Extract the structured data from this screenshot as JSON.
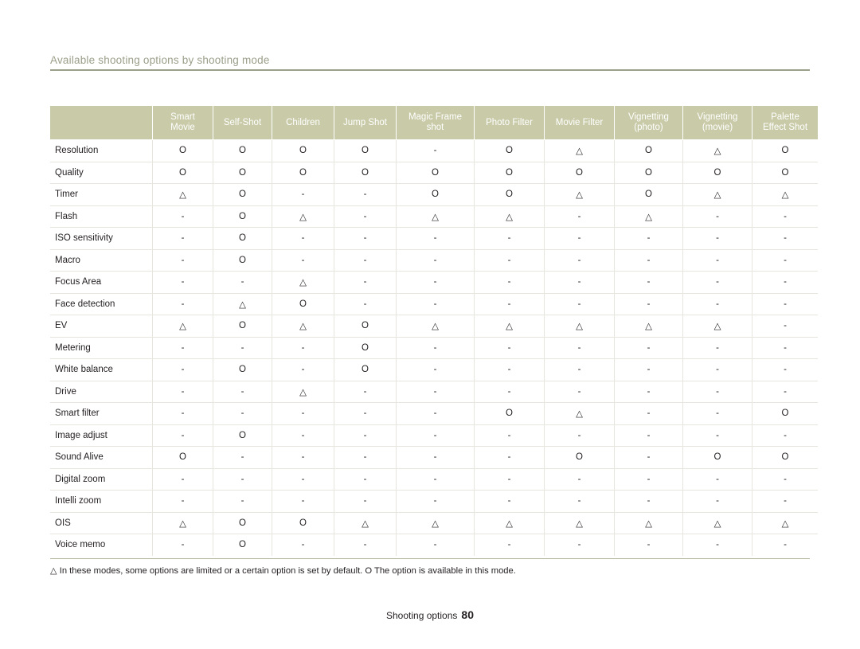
{
  "header": {
    "title": "Available shooting options by shooting mode"
  },
  "table": {
    "columns": [
      {
        "line1": "",
        "line2": "",
        "line3": ""
      },
      {
        "line1": "Smart",
        "line2": "Movie",
        "line3": ""
      },
      {
        "line1": "Self-Shot",
        "line2": "",
        "line3": ""
      },
      {
        "line1": "Children",
        "line2": "",
        "line3": ""
      },
      {
        "line1": "Jump Shot",
        "line2": "",
        "line3": ""
      },
      {
        "line1": "Magic Frame",
        "line2": "shot",
        "line3": ""
      },
      {
        "line1": "Photo Filter",
        "line2": "",
        "line3": ""
      },
      {
        "line1": "Movie Filter",
        "line2": "",
        "line3": ""
      },
      {
        "line1": "Vignetting",
        "line2": "(photo)",
        "line3": ""
      },
      {
        "line1": "Vignetting",
        "line2": "(movie)",
        "line3": ""
      },
      {
        "line1": "Palette",
        "line2": "Effect Shot",
        "line3": ""
      }
    ],
    "rows": [
      {
        "label": "Resolution",
        "cells": [
          "O",
          "O",
          "O",
          "O",
          "-",
          "O",
          "△",
          "O",
          "△",
          "O"
        ]
      },
      {
        "label": "Quality",
        "cells": [
          "O",
          "O",
          "O",
          "O",
          "O",
          "O",
          "O",
          "O",
          "O",
          "O"
        ]
      },
      {
        "label": "Timer",
        "cells": [
          "△",
          "O",
          "-",
          "-",
          "O",
          "O",
          "△",
          "O",
          "△",
          "△"
        ]
      },
      {
        "label": "Flash",
        "cells": [
          "-",
          "O",
          "△",
          "-",
          "△",
          "△",
          "-",
          "△",
          "-",
          "-"
        ]
      },
      {
        "label": "ISO sensitivity",
        "cells": [
          "-",
          "O",
          "-",
          "-",
          "-",
          "-",
          "-",
          "-",
          "-",
          "-"
        ]
      },
      {
        "label": "Macro",
        "cells": [
          "-",
          "O",
          "-",
          "-",
          "-",
          "-",
          "-",
          "-",
          "-",
          "-"
        ]
      },
      {
        "label": "Focus Area",
        "cells": [
          "-",
          "-",
          "△",
          "-",
          "-",
          "-",
          "-",
          "-",
          "-",
          "-"
        ]
      },
      {
        "label": "Face detection",
        "cells": [
          "-",
          "△",
          "O",
          "-",
          "-",
          "-",
          "-",
          "-",
          "-",
          "-"
        ]
      },
      {
        "label": "EV",
        "cells": [
          "△",
          "O",
          "△",
          "O",
          "△",
          "△",
          "△",
          "△",
          "△",
          "-"
        ]
      },
      {
        "label": "Metering",
        "cells": [
          "-",
          "-",
          "-",
          "O",
          "-",
          "-",
          "-",
          "-",
          "-",
          "-"
        ]
      },
      {
        "label": "White balance",
        "cells": [
          "-",
          "O",
          "-",
          "O",
          "-",
          "-",
          "-",
          "-",
          "-",
          "-"
        ]
      },
      {
        "label": "Drive",
        "cells": [
          "-",
          "-",
          "△",
          "-",
          "-",
          "-",
          "-",
          "-",
          "-",
          "-"
        ]
      },
      {
        "label": "Smart filter",
        "cells": [
          "-",
          "-",
          "-",
          "-",
          "-",
          "O",
          "△",
          "-",
          "-",
          "O"
        ]
      },
      {
        "label": "Image adjust",
        "cells": [
          "-",
          "O",
          "-",
          "-",
          "-",
          "-",
          "-",
          "-",
          "-",
          "-"
        ]
      },
      {
        "label": "Sound Alive",
        "cells": [
          "O",
          "-",
          "-",
          "-",
          "-",
          "-",
          "O",
          "-",
          "O",
          "O"
        ]
      },
      {
        "label": "Digital zoom",
        "cells": [
          "-",
          "-",
          "-",
          "-",
          "-",
          "-",
          "-",
          "-",
          "-",
          "-"
        ]
      },
      {
        "label": "Intelli zoom",
        "cells": [
          "-",
          "-",
          "-",
          "-",
          "-",
          "-",
          "-",
          "-",
          "-",
          "-"
        ]
      },
      {
        "label": "OIS",
        "cells": [
          "△",
          "O",
          "O",
          "△",
          "△",
          "△",
          "△",
          "△",
          "△",
          "△"
        ]
      },
      {
        "label": "Voice memo",
        "cells": [
          "-",
          "O",
          "-",
          "-",
          "-",
          "-",
          "-",
          "-",
          "-",
          "-"
        ]
      }
    ]
  },
  "note": "△ In these modes, some options are limited or a certain option is set by default. O The option is available in this mode.",
  "footer": {
    "label": "Shooting options",
    "page": "80"
  },
  "colors": {
    "header_bg": "#c9caa8",
    "header_text": "#ffffff",
    "rule": "#9aa08a",
    "grid": "#e6e6df",
    "body_text": "#231f20"
  }
}
